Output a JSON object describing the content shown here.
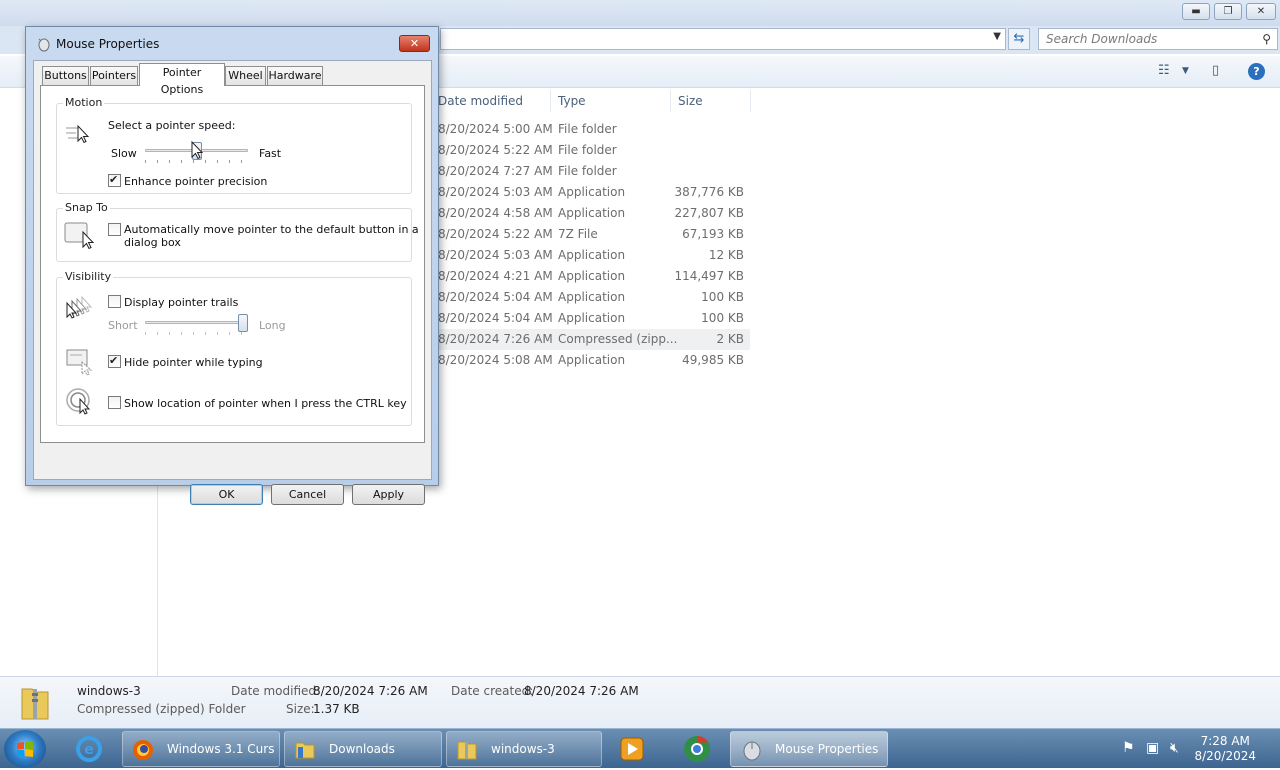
{
  "explorer": {
    "search_placeholder": "Search Downloads",
    "columns": {
      "date": "Date modified",
      "type": "Type",
      "size": "Size"
    },
    "files": [
      {
        "date": "8/20/2024 5:00 AM",
        "type": "File folder",
        "size": ""
      },
      {
        "date": "8/20/2024 5:22 AM",
        "type": "File folder",
        "size": ""
      },
      {
        "date": "8/20/2024 7:27 AM",
        "type": "File folder",
        "size": ""
      },
      {
        "date": "8/20/2024 5:03 AM",
        "type": "Application",
        "size": "387,776 KB"
      },
      {
        "date": "8/20/2024 4:58 AM",
        "type": "Application",
        "size": "227,807 KB"
      },
      {
        "date": "8/20/2024 5:22 AM",
        "type": "7Z File",
        "size": "67,193 KB"
      },
      {
        "date": "8/20/2024 5:03 AM",
        "type": "Application",
        "size": "12 KB"
      },
      {
        "date": "8/20/2024 4:21 AM",
        "type": "Application",
        "size": "114,497 KB"
      },
      {
        "date": "8/20/2024 5:04 AM",
        "type": "Application",
        "size": "100 KB"
      },
      {
        "date": "8/20/2024 5:04 AM",
        "type": "Application",
        "size": "100 KB"
      },
      {
        "date": "8/20/2024 7:26 AM",
        "type": "Compressed (zipp...",
        "size": "2 KB"
      },
      {
        "date": "8/20/2024 5:08 AM",
        "type": "Application",
        "size": "49,985 KB"
      }
    ],
    "selected_row": 10,
    "details": {
      "name": "windows-3",
      "kind": "Compressed (zipped) Folder",
      "modified_label": "Date modified:",
      "modified_value": "8/20/2024 7:26 AM",
      "created_label": "Date created:",
      "created_value": "8/20/2024 7:26 AM",
      "size_label": "Size:",
      "size_value": "1.37 KB"
    }
  },
  "dialog": {
    "title": "Mouse Properties",
    "tabs": [
      "Buttons",
      "Pointers",
      "Pointer Options",
      "Wheel",
      "Hardware"
    ],
    "active_tab": "Pointer Options",
    "motion": {
      "heading": "Motion",
      "speed_label": "Select a pointer speed:",
      "slow": "Slow",
      "fast": "Fast",
      "speed_level": 0.5,
      "precision_label": "Enhance pointer precision",
      "precision_checked": true
    },
    "snap": {
      "heading": "Snap To",
      "label_line1": "Automatically move pointer to the default button in a",
      "label_line2": "dialog box",
      "checked": false
    },
    "visibility": {
      "heading": "Visibility",
      "trails_label": "Display pointer trails",
      "trails_checked": false,
      "short": "Short",
      "long": "Long",
      "trail_level": 1.0,
      "hide_label": "Hide pointer while typing",
      "hide_checked": true,
      "ctrl_label": "Show location of pointer when I press the CTRL key",
      "ctrl_checked": false
    },
    "buttons": {
      "ok": "OK",
      "cancel": "Cancel",
      "apply": "Apply"
    }
  },
  "taskbar": {
    "tasks": [
      {
        "label": "Windows 3.1 Curs...",
        "icon": "firefox-icon"
      },
      {
        "label": "Downloads",
        "icon": "folder-icon"
      },
      {
        "label": "windows-3",
        "icon": "zip-folder-icon"
      },
      {
        "label": "Mouse Properties",
        "icon": "mouse-icon",
        "active": true
      }
    ],
    "time": "7:28 AM",
    "date": "8/20/2024"
  },
  "colors": {
    "taskbar": "#3d6590",
    "dialog_frame": "#b8cde8",
    "close_button": "#c2331c",
    "accent": "#2a6cb5"
  }
}
